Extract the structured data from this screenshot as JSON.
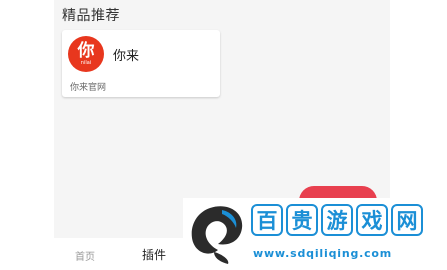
{
  "section": {
    "title": "精品推荐"
  },
  "cards": [
    {
      "logo_char": "你",
      "logo_sub": "nilai",
      "name": "你来",
      "desc": "你来官网"
    }
  ],
  "tabs": [
    {
      "label": "首页"
    },
    {
      "label": "插件"
    }
  ],
  "watermark": {
    "title": [
      "百",
      "贵",
      "游",
      "戏",
      "网"
    ],
    "url": "www.sdqiliqing.com"
  },
  "colors": {
    "accent": "#e8404f",
    "logo_bg": "#e8371e",
    "watermark": "#1b8fd6"
  }
}
